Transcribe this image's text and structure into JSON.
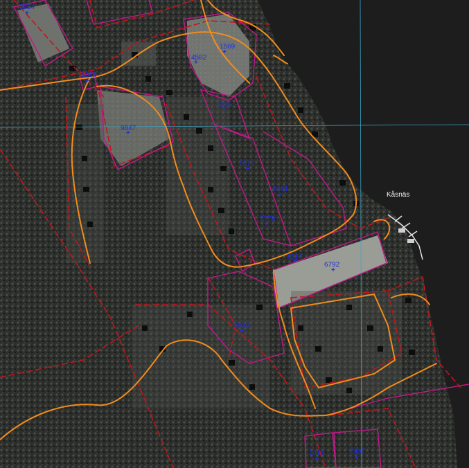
{
  "map": {
    "colors": {
      "road": "#f28c1c",
      "parcel_boundary": "#c2188a",
      "property_line": "#c1161b",
      "water": "#1a1a1a",
      "land": "#3a3d3a",
      "forest": "#2a2c2a",
      "grid_line": "#3aa6c9",
      "label": "#1f2fd6"
    },
    "parcels": [
      {
        "id": "p2624",
        "label": "2624"
      },
      {
        "id": "p1038",
        "label": "1038"
      },
      {
        "id": "p4582",
        "label": "4582"
      },
      {
        "id": "p1569",
        "label": "1569"
      },
      {
        "id": "p9369",
        "label": "9369"
      },
      {
        "id": "p9847",
        "label": "9847"
      },
      {
        "id": "p5678",
        "label": "5678"
      },
      {
        "id": "p8481",
        "label": "8481"
      },
      {
        "id": "p7779",
        "label": "7779"
      },
      {
        "id": "p8284",
        "label": "8284"
      },
      {
        "id": "p6792",
        "label": "6792"
      },
      {
        "id": "p5633",
        "label": "5633"
      },
      {
        "id": "p2488",
        "label": "2488"
      },
      {
        "id": "p2497",
        "label": "2497"
      }
    ],
    "place_label": "Kåsnäs",
    "icons": {
      "parcel_marker": "cross-marker-icon",
      "harbor": "dock-icon"
    }
  }
}
